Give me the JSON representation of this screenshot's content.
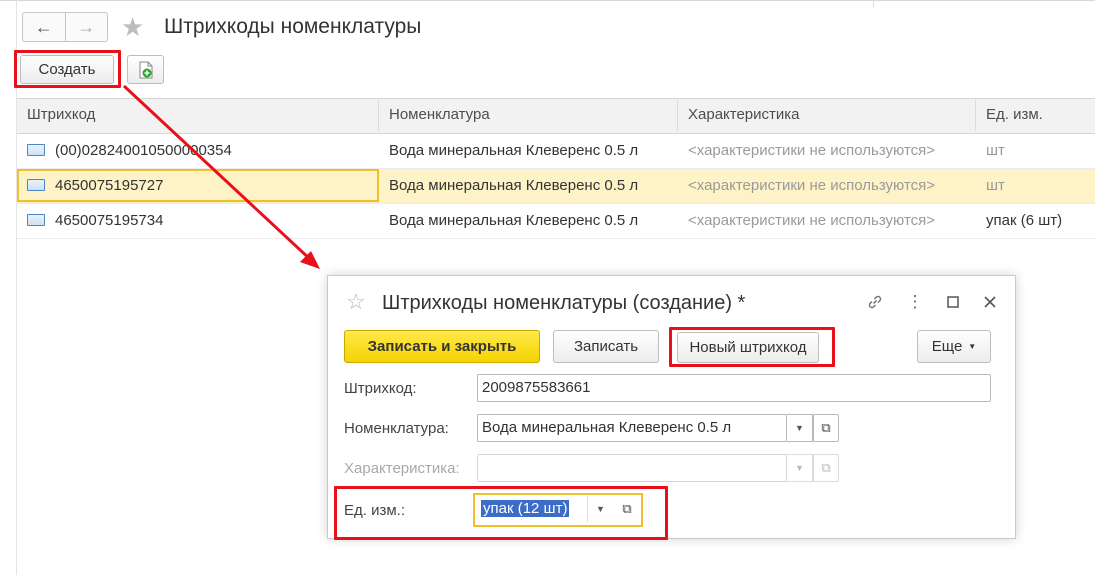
{
  "window": {
    "title": "Штрихкоды номенклатуры",
    "back_icon": "arrow-left-icon",
    "forward_icon": "arrow-right-icon",
    "favorite_icon": "star-icon"
  },
  "toolbar": {
    "create_label": "Создать",
    "copy_icon": "document-add-icon"
  },
  "table": {
    "columns": [
      "Штрихкод",
      "Номенклатура",
      "Характеристика",
      "Ед. изм."
    ],
    "rows": [
      {
        "barcode": "(00)028240010500000354",
        "item": "Вода минеральная Клеверенс 0.5 л",
        "characteristic": "<характеристики не используются>",
        "unit": "шт"
      },
      {
        "barcode": "4650075195727",
        "item": "Вода минеральная Клеверенс 0.5 л",
        "characteristic": "<характеристики не используются>",
        "unit": "шт"
      },
      {
        "barcode": "4650075195734",
        "item": "Вода минеральная Клеверенс 0.5 л",
        "characteristic": "<характеристики не используются>",
        "unit": "упак (6 шт)"
      }
    ],
    "selected_row": 1
  },
  "dialog": {
    "title": "Штрихкоды номенклатуры (создание) *",
    "icons": [
      "star-icon",
      "link-icon",
      "more-vertical-icon",
      "maximize-icon",
      "close-icon"
    ],
    "buttons": {
      "save_close": "Записать и закрыть",
      "save": "Записать",
      "new_barcode": "Новый штрихкод",
      "more": "Еще"
    },
    "fields": {
      "barcode_label": "Штрихкод:",
      "barcode_value": "2009875583661",
      "item_label": "Номенклатура:",
      "item_value": "Вода минеральная Клеверенс 0.5 л",
      "characteristic_label": "Характеристика:",
      "characteristic_value": "",
      "unit_label": "Ед. изм.:",
      "unit_value": "упак (12 шт)"
    }
  },
  "colors": {
    "highlight_red": "#e8111a",
    "selected_row": "#fdf3c6",
    "primary_button": "#f5d200",
    "selection_blue": "#3d6cc8"
  }
}
